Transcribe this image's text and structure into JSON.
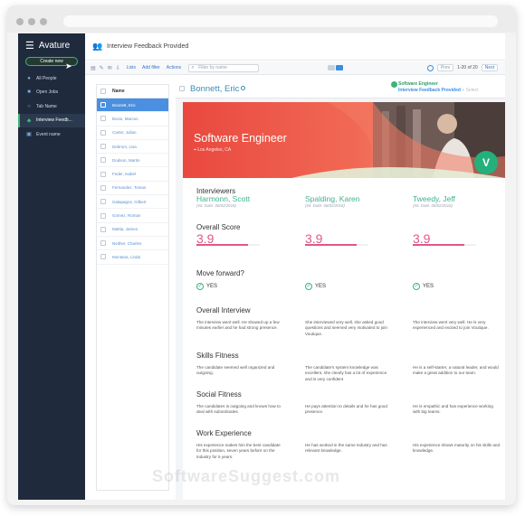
{
  "app": {
    "name": "Avature"
  },
  "sidebar": {
    "create_label": "Create new",
    "items": [
      {
        "label": "All People",
        "icon": "people-icon"
      },
      {
        "label": "Open Jobs",
        "icon": "briefcase-icon"
      },
      {
        "label": "Tab Name",
        "icon": "person-icon"
      },
      {
        "label": "Interview Feedb...",
        "icon": "feedback-icon"
      },
      {
        "label": "Event name",
        "icon": "calendar-icon"
      }
    ]
  },
  "header": {
    "title": "Interview Feedback Provided"
  },
  "toolbar": {
    "lists": "Lists",
    "add_filter": "Add filter",
    "actions": "Actions",
    "filter_placeholder": "Filter by name",
    "range": "1-20 of 20",
    "prev": "Prev",
    "next": "Next"
  },
  "list": {
    "column": "Name",
    "selected_index": 0,
    "rows": [
      "Bonnett, Eric",
      "Bosio, Marcus",
      "Carter, Julian",
      "Debrom, Lisa",
      "Dodson, Martin",
      "Feder, Isabel",
      "Fernandez, Tomas",
      "Galapagos, Gilbert",
      "Gomez, Roman",
      "Mattia, James",
      "Neither, Charles",
      "Montana, Linda"
    ]
  },
  "detail": {
    "candidate": "Bonnett, Eric",
    "job_tag": {
      "title": "Software Engineer",
      "status": "Interview Feedback Provided",
      "extra": "+ Select"
    },
    "banner": {
      "title": "Software Engineer",
      "location": "Los Angeles, CA"
    },
    "logo_letter": "V",
    "sections": {
      "interviewers": "Interviewers",
      "overall_score": "Overall Score",
      "move_forward": "Move forward?",
      "overall_interview": "Overall Interview",
      "skills_fitness": "Skills Fitness",
      "social_fitness": "Social Fitness",
      "work_experience": "Work Experience"
    },
    "interviewers": [
      {
        "name": "Harmonn, Scott",
        "date": "(Int. Date: 06/02/2016)",
        "score": "3.9",
        "score_fraction": 0.82,
        "move": "YES",
        "overall": "The interview went well. He showed up a few minutes earlier and he had strong presence.",
        "skills": "The candidate seemed well organized and outgoing.",
        "social": "The candidates is outgoing and knows how to deal with subordinates.",
        "work": "His experience makes him the best candidate for this position, seven years before on the industry for 5 years."
      },
      {
        "name": "Spalding, Karen",
        "date": "(Int. Date: 06/02/2016)",
        "score": "3.9",
        "score_fraction": 0.82,
        "move": "YES",
        "overall": "She interviewed very well, she asked good questions and seemed very motivated to join Voutique.",
        "skills": "The candidate's system knowledge was excellent, she clearly has a lot of experience and is very confident",
        "social": "He pays attention to details and he has good presence.",
        "work": "He has worked in the same industry and has relevant knowledge."
      },
      {
        "name": "Tweedy, Jeff",
        "date": "(Int. Date: 06/02/2016)",
        "score": "3.9",
        "score_fraction": 0.82,
        "move": "YES",
        "overall": "The interview went very well. He is very experienced and excited to join Voutique.",
        "skills": "He is a self-starter, a natural leader, and would make a great addition to our team.",
        "social": "He is empathic and has experience working with big teams.",
        "work": "His experience shows maturity on his skills and knowledge."
      }
    ]
  },
  "watermark": "SoftwareSuggest.com",
  "colors": {
    "accent": "#39b57a",
    "sidebar": "#1f2b3d",
    "score": "#e2568a",
    "link": "#3a8fe0"
  }
}
